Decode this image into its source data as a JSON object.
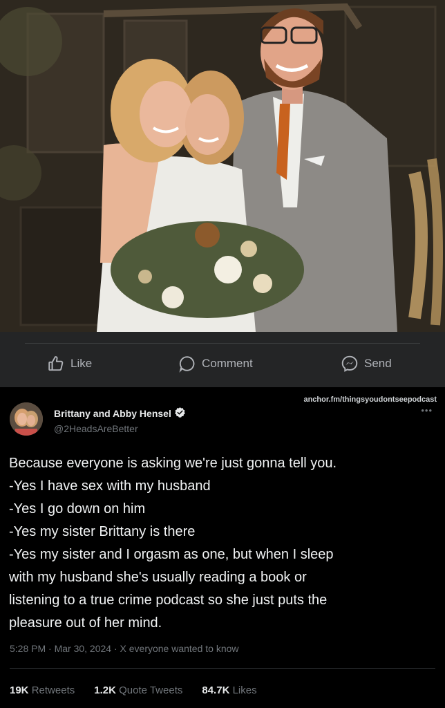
{
  "facebook_bar": {
    "like_label": "Like",
    "comment_label": "Comment",
    "send_label": "Send"
  },
  "tweet": {
    "watermark": "anchor.fm/thingsyoudontseepodcast",
    "more_icon": "•••",
    "author_name": "Brittany and Abby Hensel",
    "handle": "@2HeadsAreBetter",
    "body_lines": [
      "Because everyone is asking we're just gonna tell you.",
      "-Yes I have sex with my husband",
      "-Yes I go down on him",
      "-Yes my sister Brittany is there",
      "-Yes my sister and I orgasm as one, but when I sleep",
      "with my husband she's usually reading a book or",
      "listening to a true crime podcast so she just puts the",
      "pleasure out of her mind."
    ],
    "meta": "5:28 PM · Mar 30, 2024 · X everyone wanted to know",
    "stats": {
      "retweets_count": "19K",
      "retweets_label": "Retweets",
      "quotes_count": "1.2K",
      "quotes_label": "Quote Tweets",
      "likes_count": "84.7K",
      "likes_label": "Likes"
    }
  },
  "colors": {
    "fb_bar_bg": "#242526",
    "fb_text": "#b0b3b8",
    "tweet_bg": "#000000",
    "muted": "#71767b",
    "verified": "#1d9bf0"
  }
}
